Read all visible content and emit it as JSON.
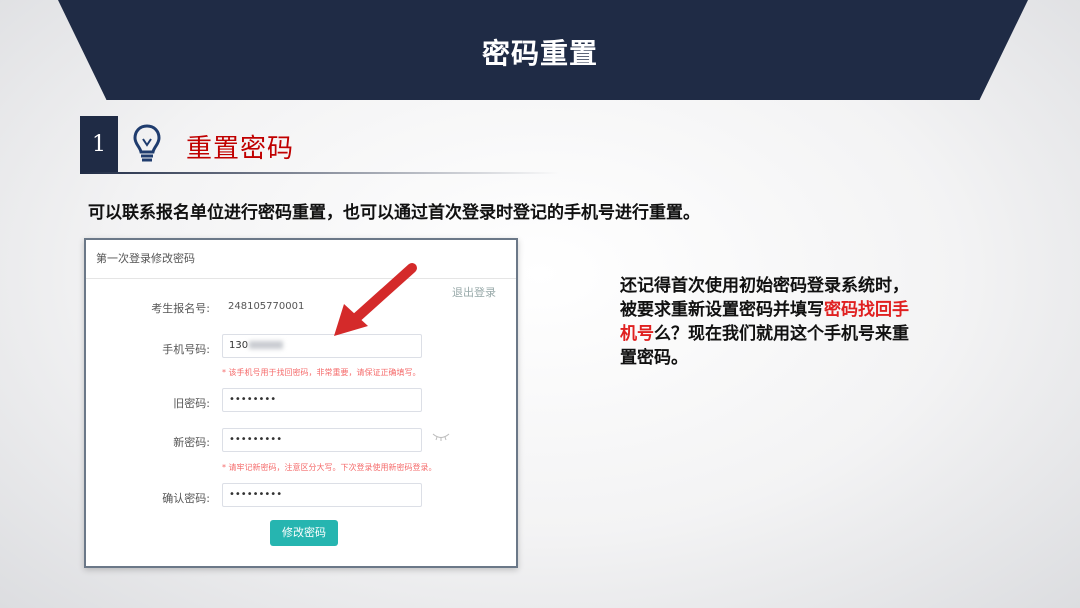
{
  "header": {
    "title": "密码重置"
  },
  "section": {
    "number": "1",
    "title": "重置密码"
  },
  "description": "可以联系报名单位进行密码重置，也可以通过首次登录时登记的手机号进行重置。",
  "screenshot": {
    "header": "第一次登录修改密码",
    "logout": "退出登录",
    "exam_id_label": "考生报名号:",
    "exam_id_value": "248105770001",
    "phone_label": "手机号码:",
    "phone_value": "130",
    "phone_hint": "* 该手机号用于找回密码，非常重要，请保证正确填写。",
    "old_pwd_label": "旧密码:",
    "old_pwd_value": "••••••••",
    "new_pwd_label": "新密码:",
    "new_pwd_value": "•••••••••",
    "new_pwd_hint": "* 请牢记新密码，注意区分大写。下次登录使用新密码登录。",
    "confirm_label": "确认密码:",
    "confirm_value": "•••••••••",
    "submit": "修改密码"
  },
  "note": {
    "before": "还记得首次使用初始密码登录系统时，被要求重新设置密码并填写",
    "highlight": "密码找回手机号",
    "after": "么？现在我们就用这个手机号来重置密码。"
  },
  "colors": {
    "banner": "#1f2b45",
    "title_red": "#c00000",
    "button": "#26b5b0",
    "highlight": "#e02020"
  },
  "icons": [
    "lightbulb-icon",
    "arrow-icon",
    "eye-closed-icon"
  ]
}
